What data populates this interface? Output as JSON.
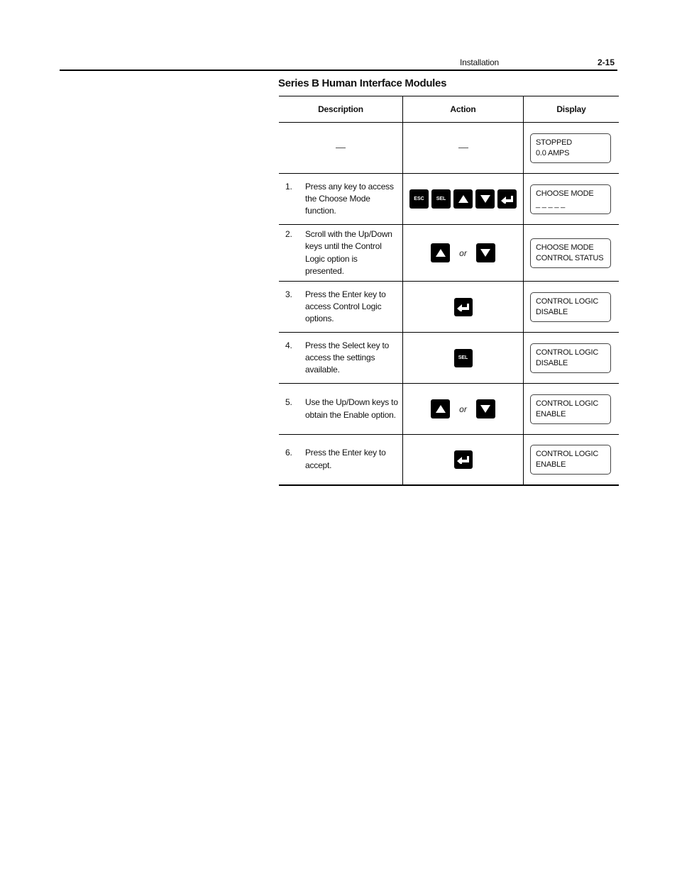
{
  "page_header": {
    "section": "Installation",
    "page_number": "2-15"
  },
  "title": "Series B Human Interface Modules",
  "table": {
    "columns": [
      "Description",
      "Action",
      "Display"
    ],
    "rows": [
      {
        "number": "",
        "description": "—",
        "action": {
          "type": "none",
          "text": "—",
          "keys": []
        },
        "display": [
          "STOPPED",
          "0.0 AMPS"
        ]
      },
      {
        "number": "1.",
        "description": "Press any key to access the Choose Mode function.",
        "action": {
          "type": "all",
          "keys": [
            "ESC",
            "SEL",
            "up-arrow",
            "down-arrow",
            "enter"
          ]
        },
        "display": [
          "CHOOSE MODE",
          "_ _ _ _ _"
        ]
      },
      {
        "number": "2.",
        "description": "Scroll with the Up/Down keys until the Control Logic option is presented.",
        "action": {
          "type": "either",
          "keys": [
            "up-arrow",
            "down-arrow"
          ],
          "connector": "or"
        },
        "display": [
          "CHOOSE MODE",
          "CONTROL STATUS"
        ]
      },
      {
        "number": "3.",
        "description": "Press the Enter key to access Control Logic options.",
        "action": {
          "type": "single",
          "keys": [
            "enter"
          ]
        },
        "display": [
          "CONTROL LOGIC",
          "DISABLE"
        ]
      },
      {
        "number": "4.",
        "description": "Press the Select key to access the settings available.",
        "action": {
          "type": "single",
          "keys": [
            "SEL"
          ]
        },
        "display": [
          "CONTROL LOGIC",
          "DISABLE"
        ]
      },
      {
        "number": "5.",
        "description": "Use the Up/Down keys to obtain the Enable option.",
        "action": {
          "type": "either",
          "keys": [
            "up-arrow",
            "down-arrow"
          ],
          "connector": "or"
        },
        "display": [
          "CONTROL LOGIC",
          "ENABLE"
        ]
      },
      {
        "number": "6.",
        "description": "Press the Enter key to accept.",
        "action": {
          "type": "single",
          "keys": [
            "enter"
          ]
        },
        "display": [
          "CONTROL LOGIC",
          "ENABLE"
        ]
      }
    ]
  },
  "key_labels": {
    "esc": "ESC",
    "sel": "SEL",
    "or": "or"
  }
}
